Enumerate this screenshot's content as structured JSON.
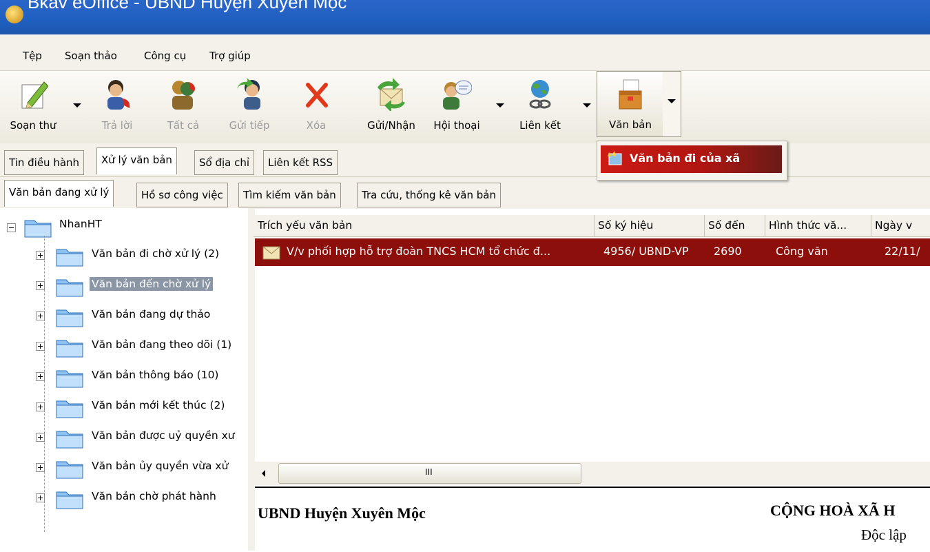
{
  "window": {
    "title": "Bkav eOffice - UBND Huyện Xuyên Mộc"
  },
  "menu": [
    "Tệp",
    "Soạn thảo",
    "Công cụ",
    "Trợ giúp"
  ],
  "toolbar": {
    "compose": "Soạn thư",
    "reply": "Trả lời",
    "reply_all": "Tất cả",
    "forward": "Gửi tiếp",
    "delete": "Xóa",
    "send_receive": "Gửi/Nhận",
    "conversation": "Hội thoại",
    "link": "Liên kết",
    "documents": "Văn bản"
  },
  "dropdown": {
    "selected_item": "Văn bản đi của xã"
  },
  "tabs_top": [
    "Tin điều hành",
    "Xử lý văn bản",
    "Sổ địa chỉ",
    "Liên kết RSS"
  ],
  "tabs_sub": [
    "Văn bản đang xử lý",
    "Hồ sơ công việc",
    "Tìm kiếm văn bản",
    "Tra cứu, thống kê văn bản"
  ],
  "tree": {
    "root": "NhanHT",
    "items": [
      "Văn bản đi chờ xử lý (2)",
      "Văn bản đến chờ xử lý",
      "Văn bản đang dự thảo",
      "Văn bản đang theo dõi (1)",
      "Văn bản thông báo (10)",
      "Văn bản mới kết thúc (2)",
      "Văn bản được uỷ quyền xư",
      "Văn bản ủy quyền vừa xử",
      "Văn bản chờ phát hành"
    ],
    "selected_index": 1
  },
  "list": {
    "columns": [
      "Trích yếu văn bản",
      "Số ký hiệu",
      "Số đến",
      "Hình thức vă...",
      "Ngày v"
    ],
    "rows": [
      {
        "summary": "V/v phối hợp hỗ trợ đoàn TNCS HCM tổ chức đ...",
        "code": "4956/ UBND-VP",
        "number": "2690",
        "type": "Công văn",
        "date": "22/11/"
      }
    ]
  },
  "scroll": {
    "grip": "III"
  },
  "preview": {
    "org": "UBND Huyện Xuyên Mộc",
    "header_right": "CỘNG HOÀ XÃ H",
    "motto": "Độc lập"
  }
}
